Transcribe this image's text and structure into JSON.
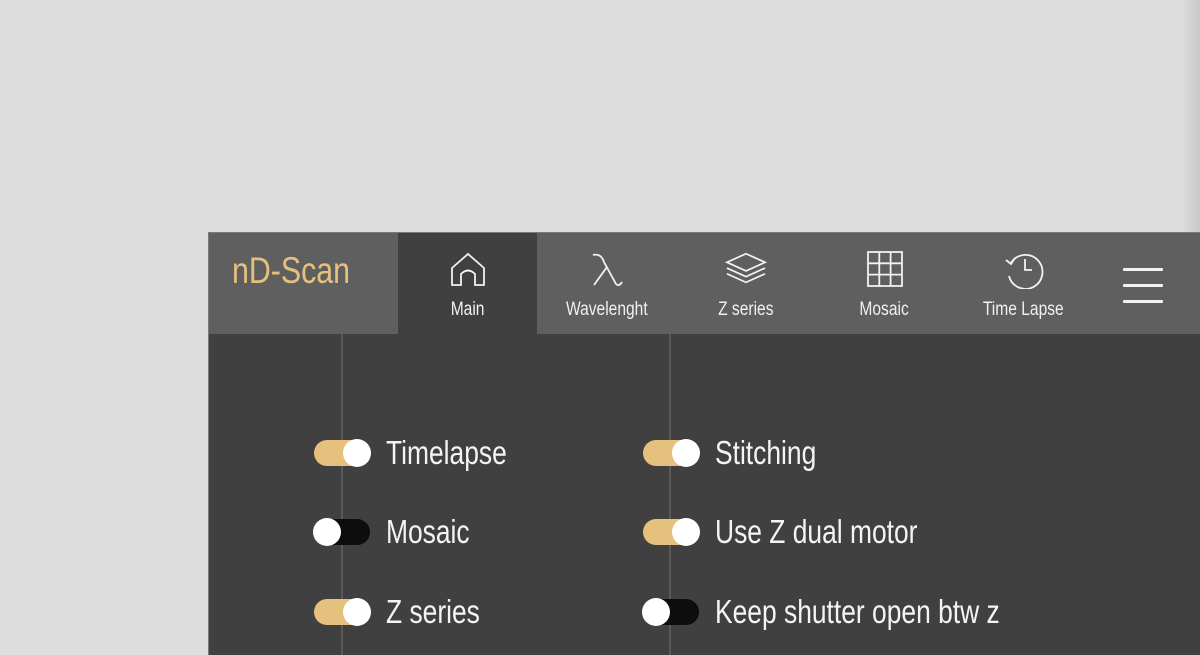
{
  "app": {
    "title": "nD-Scan"
  },
  "colors": {
    "accent": "#e6c17e",
    "topbar": "#5f5f60",
    "panel": "#404040",
    "toggle_off": "#0d0d0d"
  },
  "tabs": [
    {
      "label": "Main",
      "icon": "home-icon",
      "active": true
    },
    {
      "label": "Wavelenght",
      "icon": "lambda-icon",
      "active": false
    },
    {
      "label": "Z series",
      "icon": "layers-icon",
      "active": false
    },
    {
      "label": "Mosaic",
      "icon": "grid-icon",
      "active": false
    },
    {
      "label": "Time Lapse",
      "icon": "clock-history-icon",
      "active": false
    }
  ],
  "menu": {
    "icon": "hamburger-menu-icon"
  },
  "options_left": [
    {
      "label": "Timelapse",
      "enabled": true
    },
    {
      "label": "Mosaic",
      "enabled": false
    },
    {
      "label": "Z series",
      "enabled": true
    }
  ],
  "options_right": [
    {
      "label": "Stitching",
      "enabled": true
    },
    {
      "label": "Use Z dual motor",
      "enabled": true
    },
    {
      "label": "Keep shutter open btw z",
      "enabled": false
    }
  ]
}
